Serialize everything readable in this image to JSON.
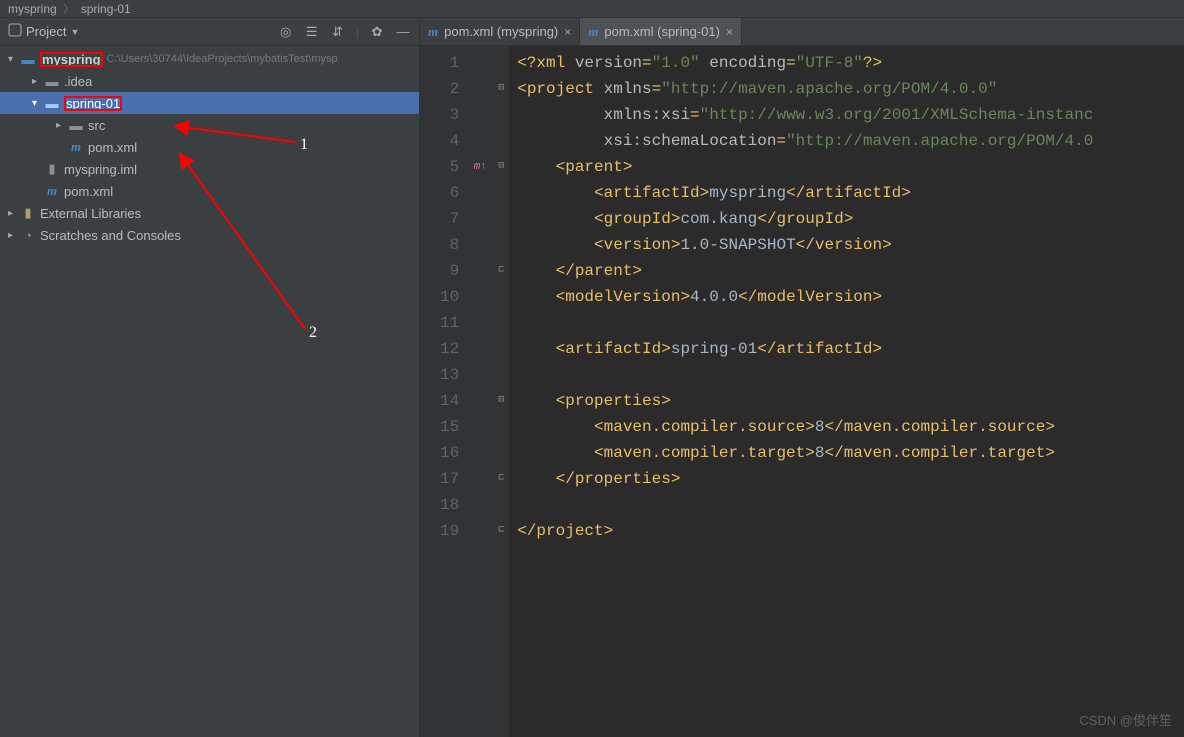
{
  "breadcrumb": {
    "item1": "myspring",
    "item2": "spring-01"
  },
  "toolWindow": {
    "title": "Project"
  },
  "tree": {
    "root": {
      "name": "myspring",
      "path": "C:\\Users\\30744\\IdeaProjects\\mybatisTest\\mysp"
    },
    "idea": ".idea",
    "spring01": "spring-01",
    "src": "src",
    "pomInner": "pom.xml",
    "iml": "myspring.iml",
    "pomOuter": "pom.xml",
    "extLib": "External Libraries",
    "scratches": "Scratches and Consoles"
  },
  "tabs": {
    "tab1": "pom.xml (myspring)",
    "tab2": "pom.xml (spring-01)"
  },
  "code": {
    "l1": "<?xml version=\"1.0\" encoding=\"UTF-8\"?>",
    "l2": "<project xmlns=\"http://maven.apache.org/POM/4.0.0\"",
    "l3": "         xmlns:xsi=\"http://www.w3.org/2001/XMLSchema-instanc",
    "l4": "         xsi:schemaLocation=\"http://maven.apache.org/POM/4.0",
    "l5": "    <parent>",
    "l6": "        <artifactId>myspring</artifactId>",
    "l7": "        <groupId>com.kang</groupId>",
    "l8": "        <version>1.0-SNAPSHOT</version>",
    "l9": "    </parent>",
    "l10": "    <modelVersion>4.0.0</modelVersion>",
    "l11": "",
    "l12": "    <artifactId>spring-01</artifactId>",
    "l13": "",
    "l14": "    <properties>",
    "l15": "        <maven.compiler.source>8</maven.compiler.source>",
    "l16": "        <maven.compiler.target>8</maven.compiler.target>",
    "l17": "    </properties>",
    "l18": "",
    "l19": "</project>"
  },
  "gutterMark": "m↑",
  "annotations": {
    "n1": "1",
    "n2": "2"
  },
  "watermark": "CSDN @俊伴笙"
}
